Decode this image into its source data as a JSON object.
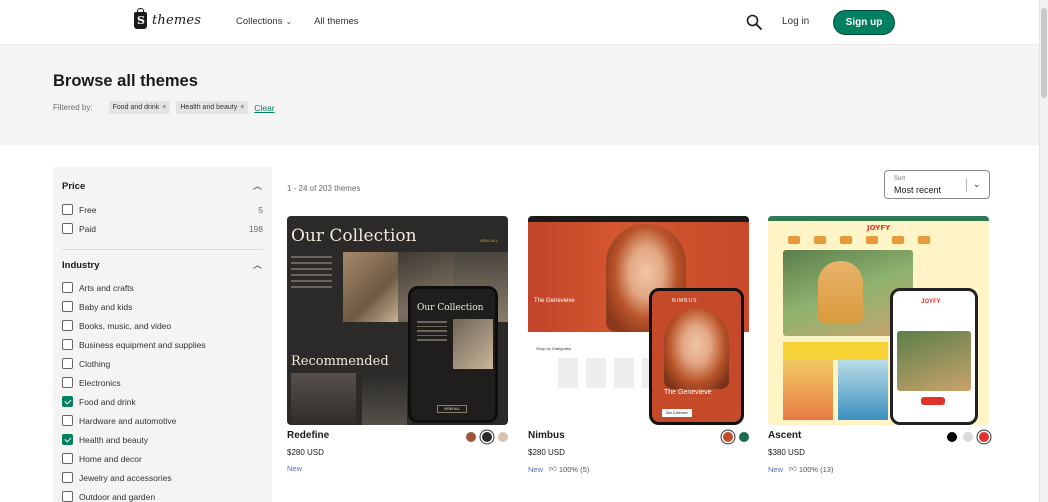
{
  "header": {
    "logo_text": "themes",
    "nav": [
      {
        "label": "Collections"
      },
      {
        "label": "All themes"
      }
    ],
    "login_label": "Log in",
    "signup_label": "Sign up"
  },
  "banner": {
    "title": "Browse all themes",
    "filtered_label": "Filtered by:",
    "chips": [
      "Food and drink",
      "Health and beauty"
    ],
    "clear_label": "Clear"
  },
  "sidebar": {
    "price": {
      "title": "Price",
      "items": [
        {
          "label": "Free",
          "count": "5",
          "checked": false
        },
        {
          "label": "Paid",
          "count": "198",
          "checked": false
        }
      ]
    },
    "industry": {
      "title": "Industry",
      "items": [
        {
          "label": "Arts and crafts",
          "checked": false
        },
        {
          "label": "Baby and kids",
          "checked": false
        },
        {
          "label": "Books, music, and video",
          "checked": false
        },
        {
          "label": "Business equipment and supplies",
          "checked": false
        },
        {
          "label": "Clothing",
          "checked": false
        },
        {
          "label": "Electronics",
          "checked": false
        },
        {
          "label": "Food and drink",
          "checked": true
        },
        {
          "label": "Hardware and automotive",
          "checked": false
        },
        {
          "label": "Health and beauty",
          "checked": true
        },
        {
          "label": "Home and decor",
          "checked": false
        },
        {
          "label": "Jewelry and accessories",
          "checked": false
        },
        {
          "label": "Outdoor and garden",
          "checked": false
        }
      ]
    }
  },
  "results": {
    "count_text": "1 - 24 of 203 themes",
    "sort_label": "Sort",
    "sort_value": "Most recent"
  },
  "themes": [
    {
      "name": "Redefine",
      "price": "$280 USD",
      "badge": "New",
      "rating": "",
      "swatches": [
        "#a0553a",
        "#2b2a28",
        "#d9c3b0"
      ],
      "selected_swatch": 1,
      "preview": {
        "headline": "Our Collection",
        "view_all": "VIEW ALL",
        "section": "Recommended",
        "phone_title": "Our Collection",
        "phone_button": "VIEW ALL"
      }
    },
    {
      "name": "Nimbus",
      "price": "$280 USD",
      "badge": "New",
      "rating": "100% (5)",
      "swatches": [
        "#c54a29",
        "#1d6b4f"
      ],
      "selected_swatch": 0,
      "preview": {
        "headline": "The Genevieve",
        "shop": "Shop by Categories",
        "phone_brand": "NIMBUS",
        "phone_headline": "The Genevieve",
        "phone_button": "See Collection"
      }
    },
    {
      "name": "Ascent",
      "price": "$380 USD",
      "badge": "New",
      "rating": "100% (13)",
      "swatches": [
        "#000000",
        "#d9d9d9",
        "#e0332b"
      ],
      "selected_swatch": 2,
      "preview": {
        "brand": "JOYFY",
        "phone_brand": "JOYFY"
      }
    }
  ],
  "colors": {
    "accent": "#008060",
    "new_badge": "#5c6ac4",
    "banner_bg": "#f4f4f4"
  }
}
